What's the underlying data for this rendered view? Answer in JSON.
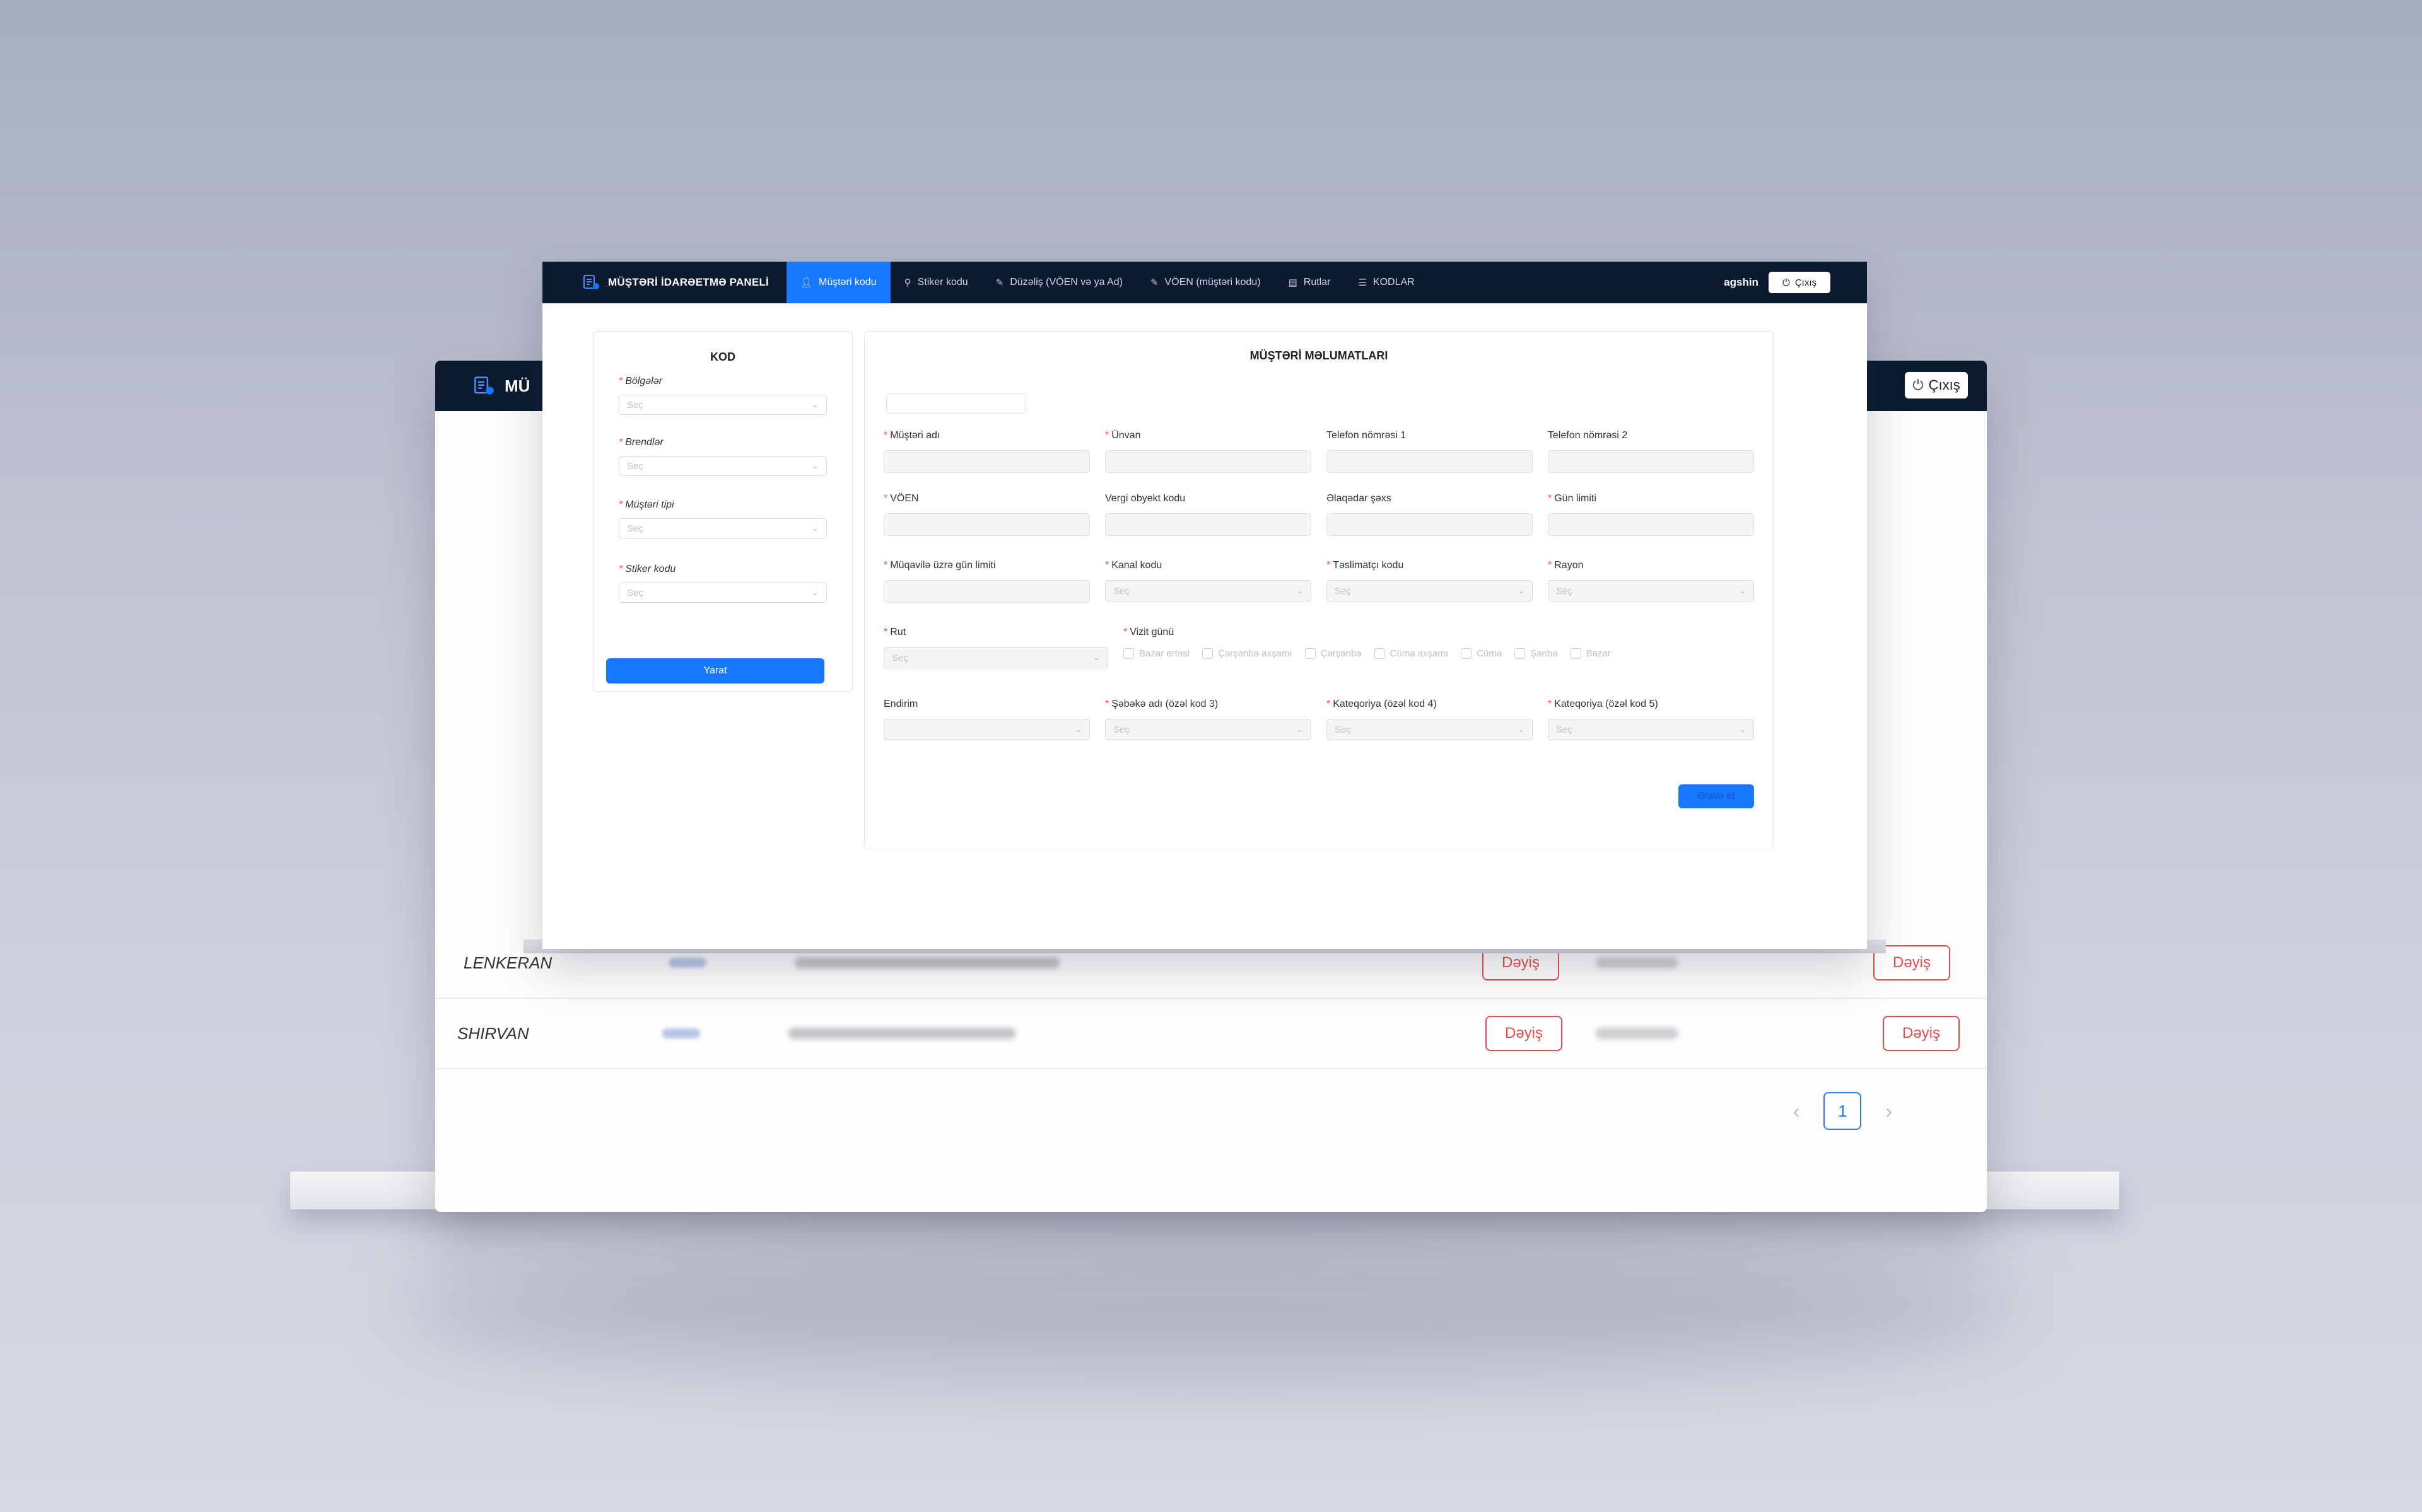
{
  "app": {
    "title": "MÜŞTƏRİ İDARƏETMƏ PANELİ",
    "brand_short": "MÜ"
  },
  "nav": {
    "items": [
      {
        "label": "Müştəri kodu",
        "icon": "user-icon",
        "active": true
      },
      {
        "label": "Stiker kodu",
        "icon": "user-search-icon",
        "active": false
      },
      {
        "label": "Düzəliş (VÖEN və ya Ad)",
        "icon": "edit-icon",
        "active": false
      },
      {
        "label": "VÖEN (müştəri kodu)",
        "icon": "edit-icon",
        "active": false
      },
      {
        "label": "Rutlar",
        "icon": "route-icon",
        "active": false
      },
      {
        "label": "KODLAR",
        "icon": "list-icon",
        "active": false
      }
    ],
    "username": "agshin",
    "logout_label": "Çıxış"
  },
  "kod_card": {
    "title": "KOD",
    "fields": [
      {
        "label": "Bölgələr",
        "required": true,
        "placeholder": "Seç"
      },
      {
        "label": "Brendlər",
        "required": true,
        "placeholder": "Seç"
      },
      {
        "label": "Müştəri tipi",
        "required": true,
        "placeholder": "Seç"
      },
      {
        "label": "Stiker kodu",
        "required": true,
        "placeholder": "Seç"
      }
    ],
    "submit_label": "Yarat"
  },
  "info_card": {
    "title": "MÜŞTƏRİ MƏLUMATLARI",
    "row1": [
      {
        "label": "Müştəri adı",
        "required": true
      },
      {
        "label": "Ünvan",
        "required": true
      },
      {
        "label": "Telefon nömrəsi 1",
        "required": false
      },
      {
        "label": "Telefon nömrəsi 2",
        "required": false
      }
    ],
    "row2": [
      {
        "label": "VÖEN",
        "required": true
      },
      {
        "label": "Vergi obyekt kodu",
        "required": false
      },
      {
        "label": "Əlaqədar şəxs",
        "required": false
      },
      {
        "label": "Gün limiti",
        "required": true
      }
    ],
    "row3": [
      {
        "label": "Müqavilə üzrə gün limiti",
        "required": true,
        "type": "input"
      },
      {
        "label": "Kanal kodu",
        "required": true,
        "type": "select",
        "placeholder": "Seç"
      },
      {
        "label": "Təslimatçı kodu",
        "required": true,
        "type": "select",
        "placeholder": "Seç"
      },
      {
        "label": "Rayon",
        "required": true,
        "type": "select",
        "placeholder": "Seç"
      }
    ],
    "rut": {
      "label": "Rut",
      "required": true,
      "placeholder": "Seç"
    },
    "vizit": {
      "label": "Vizit günü",
      "required": true,
      "days": [
        "Bazar ertəsi",
        "Çərşənbə axşamı",
        "Çərşənbə",
        "Cümə axşamı",
        "Cümə",
        "Şənbə",
        "Bazar"
      ]
    },
    "row5": [
      {
        "label": "Endirim",
        "required": false,
        "placeholder": ""
      },
      {
        "label": "Şəbəkə adı (özəl kod 3)",
        "required": true,
        "placeholder": "Seç"
      },
      {
        "label": "Kateqoriya (özəl kod 4)",
        "required": true,
        "placeholder": "Seç"
      },
      {
        "label": "Kateqoriya (özəl kod 5)",
        "required": true,
        "placeholder": "Seç"
      }
    ],
    "save_label": "Əlavə et"
  },
  "back_table": {
    "logout_label": "Çıxış",
    "rows": [
      {
        "region": "LENKERAN",
        "action_left": "Dəyiş",
        "action_right": "Dəyiş"
      },
      {
        "region": "SHIRVAN",
        "action_left": "Dəyiş",
        "action_right": "Dəyiş"
      }
    ],
    "pagination": {
      "current": "1",
      "prev": "‹",
      "next": "›"
    }
  },
  "colors": {
    "nav_bg": "#0b1a2e",
    "primary": "#1677ff",
    "danger": "#e34d4d",
    "required": "#ff4d4f"
  }
}
